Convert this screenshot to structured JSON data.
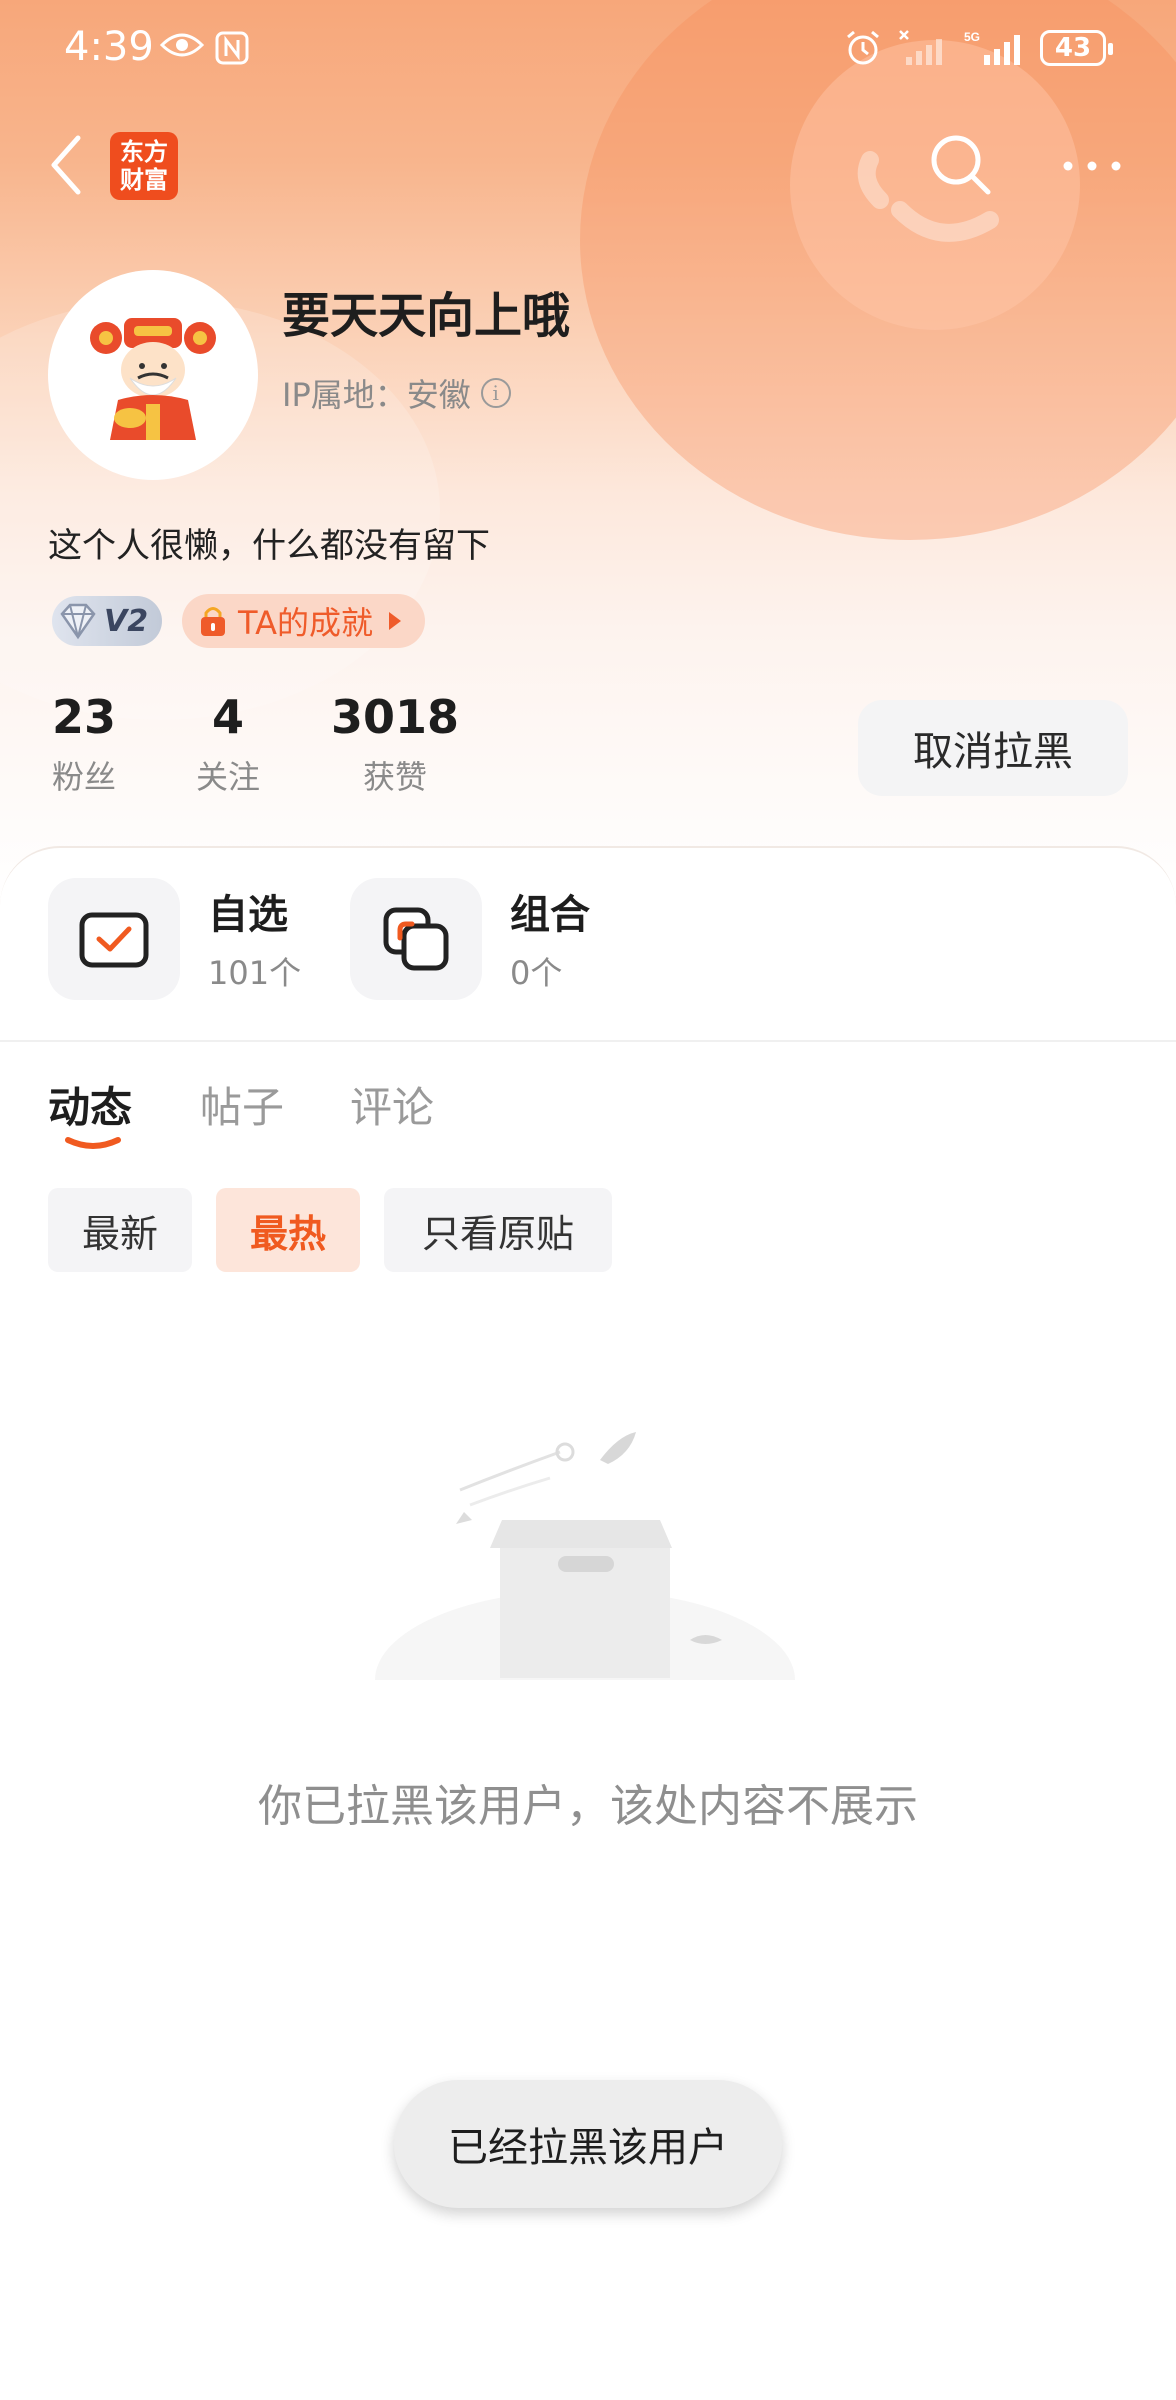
{
  "status_bar": {
    "time": "4:39",
    "battery": "43"
  },
  "app": {
    "logo_line1": "东方",
    "logo_line2": "财富"
  },
  "profile": {
    "username": "要天天向上哦",
    "ip_location": "IP属地：安徽",
    "bio": "这个人很懒，什么都没有留下",
    "level_badge": "V2",
    "achievement_label": "TA的成就"
  },
  "stats": [
    {
      "value": "23",
      "label": "粉丝"
    },
    {
      "value": "4",
      "label": "关注"
    },
    {
      "value": "3018",
      "label": "获赞"
    }
  ],
  "unblock_button": "取消拉黑",
  "quick_entries": [
    {
      "title": "自选",
      "subtitle": "101个"
    },
    {
      "title": "组合",
      "subtitle": "0个"
    }
  ],
  "tabs": [
    "动态",
    "帖子",
    "评论"
  ],
  "filters": [
    "最新",
    "最热",
    "只看原贴"
  ],
  "empty_message": "你已拉黑该用户，该处内容不展示",
  "toast": "已经拉黑该用户",
  "colors": {
    "accent": "#f05a20",
    "brand_red": "#ef4d1e"
  }
}
